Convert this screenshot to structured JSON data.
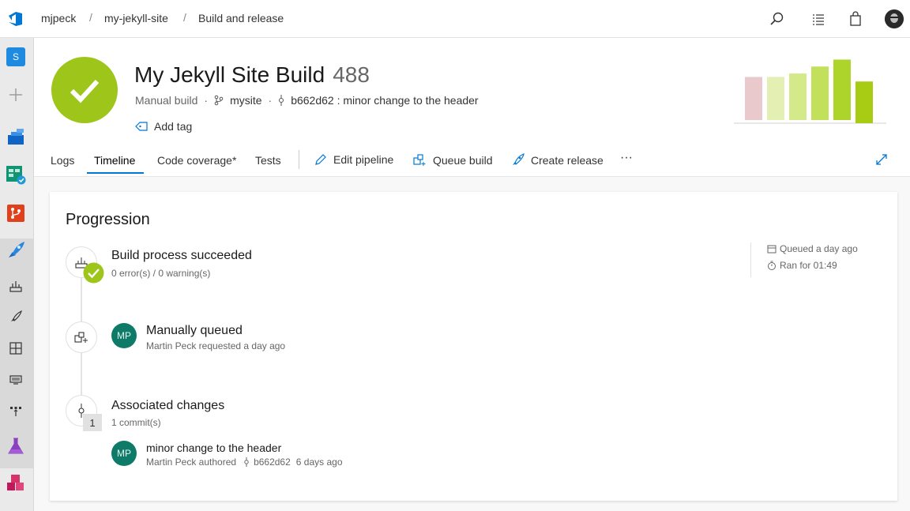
{
  "breadcrumb": {
    "org": "mjpeck",
    "project": "my-jekyll-site",
    "section": "Build and release",
    "separator": "/"
  },
  "topbar_icons": [
    "search-icon",
    "list-icon",
    "shopping-bag-icon",
    "user-avatar"
  ],
  "sidebar": {
    "project_initial": "S",
    "items": [
      "add-icon",
      "boards-icon",
      "work-icon",
      "repos-icon",
      "pipelines-icon",
      "builds-icon",
      "releases-icon",
      "library-icon",
      "task-groups-icon",
      "deployment-groups-icon",
      "test-plans-icon",
      "artifacts-icon"
    ]
  },
  "build": {
    "name": "My Jekyll Site Build",
    "number": "488",
    "trigger": "Manual build",
    "branch": "mysite",
    "commit": "b662d62 : minor change to the header",
    "add_tag": "Add tag",
    "status_color": "#9ec51a"
  },
  "tabs": [
    "Logs",
    "Timeline",
    "Code coverage*",
    "Tests"
  ],
  "active_tab": "Timeline",
  "actions": {
    "edit": "Edit pipeline",
    "queue": "Queue build",
    "release": "Create release",
    "more": "···"
  },
  "history_chart": {
    "bars": [
      {
        "value": 0.62,
        "color": "#eac9cd"
      },
      {
        "value": 0.62,
        "color": "#e3efb3"
      },
      {
        "value": 0.67,
        "color": "#d4e98a"
      },
      {
        "value": 0.77,
        "color": "#c2e05a"
      },
      {
        "value": 0.87,
        "color": "#acd42a"
      },
      {
        "value": 0.6,
        "color": "#a8cc14"
      }
    ]
  },
  "progression": {
    "title": "Progression",
    "steps": [
      {
        "title": "Build process succeeded",
        "subtitle": "0 error(s) / 0 warning(s)"
      },
      {
        "title": "Manually queued",
        "subtitle": "Martin Peck requested a day ago",
        "avatar": "MP"
      },
      {
        "title": "Associated changes",
        "subtitle": "1 commit(s)",
        "badge": "1"
      }
    ],
    "commit": {
      "message": "minor change to the header",
      "author": "Martin Peck authored",
      "hash": "b662d62",
      "age": "6 days ago",
      "avatar": "MP"
    },
    "queued": "Queued a day ago",
    "ran": "Ran for 01:49"
  }
}
